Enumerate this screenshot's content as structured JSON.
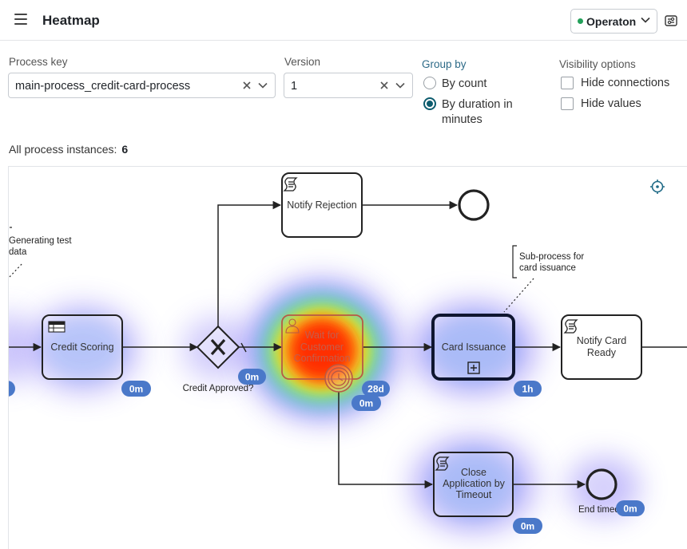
{
  "header": {
    "title": "Heatmap",
    "engine": "Operaton",
    "engine_status_color": "#23a05a"
  },
  "filters": {
    "process_key_label": "Process key",
    "process_key_value": "main-process_credit-card-process",
    "version_label": "Version",
    "version_value": "1",
    "group_by_label": "Group by",
    "group_by_options": [
      {
        "label_line1": "By count",
        "label_line2": "",
        "selected": false
      },
      {
        "label_line1": "By duration in",
        "label_line2": "minutes",
        "selected": true
      }
    ],
    "visibility_label": "Visibility options",
    "visibility_options": [
      {
        "label": "Hide connections",
        "checked": false
      },
      {
        "label": "Hide values",
        "checked": false
      }
    ]
  },
  "summary": {
    "instances_label": "All process instances:",
    "instances_count": "6"
  },
  "diagram": {
    "annotations": {
      "generating_line1": "Generating test",
      "generating_line2": "data",
      "subprocess_line1": "Sub-process for",
      "subprocess_line2": "card issuance"
    },
    "tasks": {
      "notify_rejection": "Notify Rejection",
      "credit_scoring": "Credit Scoring",
      "wait_line1": "Wait for",
      "wait_line2": "Customer",
      "wait_line3": "Confirmation",
      "card_issuance": "Card Issuance",
      "notify_ready_line1": "Notify Card",
      "notify_ready_line2": "Ready",
      "close_line1": "Close",
      "close_line2": "Application by",
      "close_line3": "Timeout"
    },
    "labels": {
      "gateway": "Credit Approved?",
      "end_timed": "End timed"
    },
    "badges": {
      "credit_scoring": "0m",
      "gateway": "0m",
      "wait": "28d",
      "timer": "0m",
      "card_issuance": "1h",
      "close": "0m",
      "end_timed": "0m"
    },
    "colors": {
      "badge": "#4a78c9",
      "heat_cool": "#7b6cf5",
      "heat_hot": "#ff2a00"
    }
  }
}
